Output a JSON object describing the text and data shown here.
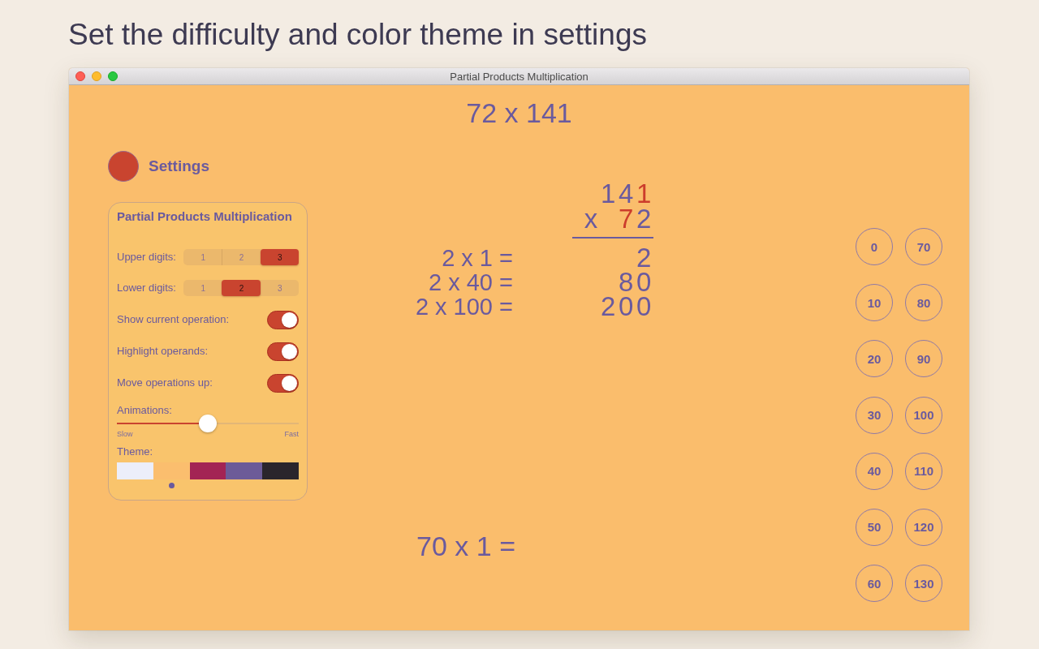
{
  "caption": "Set the difficulty and color theme in settings",
  "window": {
    "title": "Partial Products Multiplication"
  },
  "problem": "72 x 141",
  "settings": {
    "label": "Settings",
    "panel": {
      "title": "Partial Products Multiplication",
      "digit_choices": [
        {
          "label": "Upper digits:",
          "options": [
            {
              "label": "1",
              "selected": false
            },
            {
              "label": "2",
              "selected": false
            },
            {
              "label": "3",
              "selected": true
            }
          ]
        },
        {
          "label": "Lower digits:",
          "options": [
            {
              "label": "1",
              "selected": false
            },
            {
              "label": "2",
              "selected": true
            },
            {
              "label": "3",
              "selected": false
            }
          ]
        }
      ],
      "switches": [
        {
          "label": "Show current operation:",
          "on": true
        },
        {
          "label": "Highlight operands:",
          "on": true
        },
        {
          "label": "Move operations up:",
          "on": true
        }
      ],
      "animations": {
        "label": "Animations:",
        "level": 0.5,
        "min_label": "Slow",
        "max_label": "Fast"
      },
      "theme": {
        "label": "Theme:",
        "swatches": [
          {
            "color": "#eceefa",
            "selected": false
          },
          {
            "color": "#fbbe6e",
            "selected": true
          },
          {
            "color": "#a32454",
            "selected": false
          },
          {
            "color": "#6c5b98",
            "selected": false
          },
          {
            "color": "#2a252c",
            "selected": false
          }
        ]
      }
    }
  },
  "multiplication": {
    "multiplicand": [
      {
        "digit": "1",
        "highlighted": false
      },
      {
        "digit": "4",
        "highlighted": false
      },
      {
        "digit": "1",
        "highlighted": true
      }
    ],
    "operator": "x",
    "multiplier": [
      {
        "digit": "7",
        "highlighted": true
      },
      {
        "digit": "2",
        "highlighted": false
      }
    ],
    "steps": [
      {
        "operation": "2 x 1 =",
        "result": "2"
      },
      {
        "operation": "2 x 40 =",
        "result": "80"
      },
      {
        "operation": "2 x 100 =",
        "result": "200"
      }
    ]
  },
  "current_operation": "70 x 1 =",
  "answers": [
    "0",
    "10",
    "20",
    "30",
    "40",
    "50",
    "60",
    "70",
    "80",
    "90",
    "100",
    "110",
    "120",
    "130"
  ]
}
